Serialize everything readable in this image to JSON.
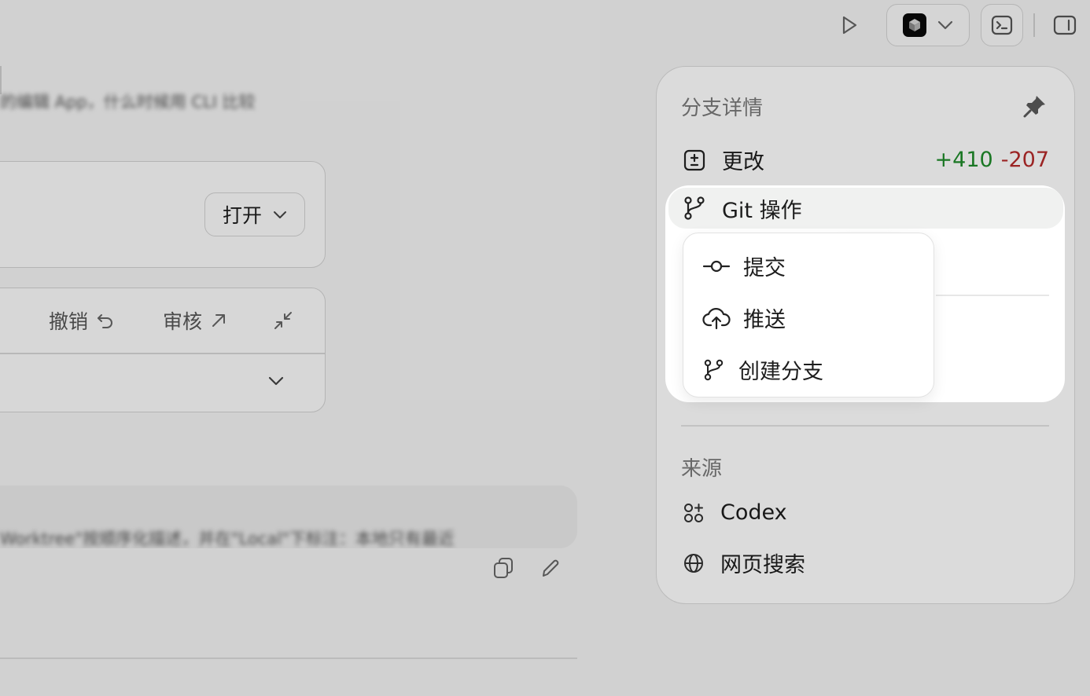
{
  "toolbar": {
    "run_icon": "play-icon",
    "agent_avatar_icon": "cube-icon",
    "agent_dropdown_icon": "chevron-down-icon",
    "terminal_icon": "terminal-icon",
    "sidebar_icon": "sidebar-toggle-icon"
  },
  "conversation": {
    "blurred_line_1": "的编辑 App，什么时候用 CLI 比较",
    "open_button_label": "打开",
    "undo_label": "撤销",
    "review_label": "审核",
    "prompt_preview": "Worktree\"按顺序化描述，并在\"Local\"下标注：本地只有最近"
  },
  "branch_panel": {
    "title": "分支详情",
    "changes": {
      "label": "更改",
      "additions": "+410",
      "deletions": "-207"
    },
    "git_actions": {
      "label": "Git 操作"
    },
    "source_section": {
      "label": "来源",
      "items": [
        {
          "label": "Codex",
          "icon": "codex-icon"
        },
        {
          "label": "网页搜索",
          "icon": "globe-icon"
        }
      ]
    }
  },
  "git_menu": {
    "items": [
      {
        "label": "提交",
        "icon": "commit-icon"
      },
      {
        "label": "推送",
        "icon": "cloud-upload-icon"
      },
      {
        "label": "创建分支",
        "icon": "git-branch-icon"
      }
    ]
  },
  "colors": {
    "additions": "#1f8b2a",
    "deletions": "#b52a2a",
    "dim_overlay": "rgba(0,0,0,0.14)"
  }
}
